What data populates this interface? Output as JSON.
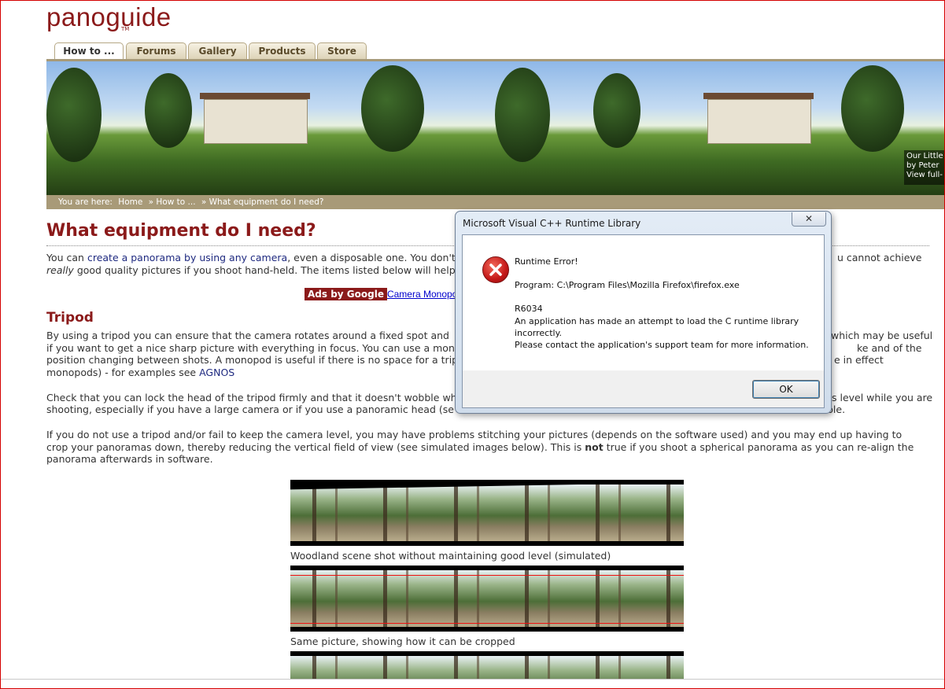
{
  "brand": {
    "logo": "panoguide",
    "tm": "TM"
  },
  "tabs": [
    "How to ...",
    "Forums",
    "Gallery",
    "Products",
    "Store"
  ],
  "banner": {
    "caption": [
      "Our Little",
      "by Peter",
      "View full-"
    ]
  },
  "breadcrumb": {
    "prefix": "You are here:",
    "items": [
      "Home",
      "» How to ...",
      "» What equipment do I need?"
    ]
  },
  "article": {
    "title": "What equipment do I need?",
    "intro": {
      "pre": "You can ",
      "link": "create a panorama by using any camera",
      "mid": ", even a disposable one. You don't",
      "tail": "u cannot achieve",
      "line2_em": "really",
      "line2": " good quality pictures if you shoot hand-held. The items listed below will help"
    },
    "ads": {
      "badge": "Ads by Google",
      "link": "Camera Monopod"
    },
    "tripod": {
      "heading": "Tripod",
      "l1a": "By using a tripod you can ensure that the camera rotates around a fixed spot and",
      "l1b": "which may be useful",
      "l2a": "if you want to get a nice sharp picture with everything in focus. You can use a mono",
      "l2b": "ke and of the",
      "l3a": "position changing between shots. A monopod is useful if there is no space for a trip",
      "l3b": "e in effect",
      "l4a": "monopods) - for examples see ",
      "l4link": "AGNOS",
      "p2l1a": "Check that you can lock the head of the tripod firmly and that it doesn't wobble wh",
      "p2l1b": "s level while you are",
      "p2l2a": "shooting, especially if you have a large camera or if you use a panoramic head (se",
      "p2l2b": "ble.",
      "p3l1": "If you do not use a tripod and/or fail to keep the camera level, you may have problems stitching your pictures (depends on the software used) and you may end up having to",
      "p3l2": "crop your panoramas down, thereby reducing the vertical field of view (see simulated images below). This is ",
      "p3bold": "not",
      "p3l2b": " true if you shoot a spherical panorama as you can re-align the",
      "p3l3": "panorama afterwards in software."
    },
    "captions": [
      "Woodland scene shot without maintaining good level (simulated)",
      "Same picture, showing how it can be cropped"
    ]
  },
  "dialog": {
    "title": "Microsoft Visual C++ Runtime Library",
    "close": "✕",
    "line1": "Runtime Error!",
    "line2": "Program: C:\\Program Files\\Mozilla Firefox\\firefox.exe",
    "line3": "R6034",
    "line4": "An application has made an attempt to load the C runtime library",
    "line5": "incorrectly.",
    "line6": "Please contact the application's support team for more information.",
    "ok": "OK"
  }
}
